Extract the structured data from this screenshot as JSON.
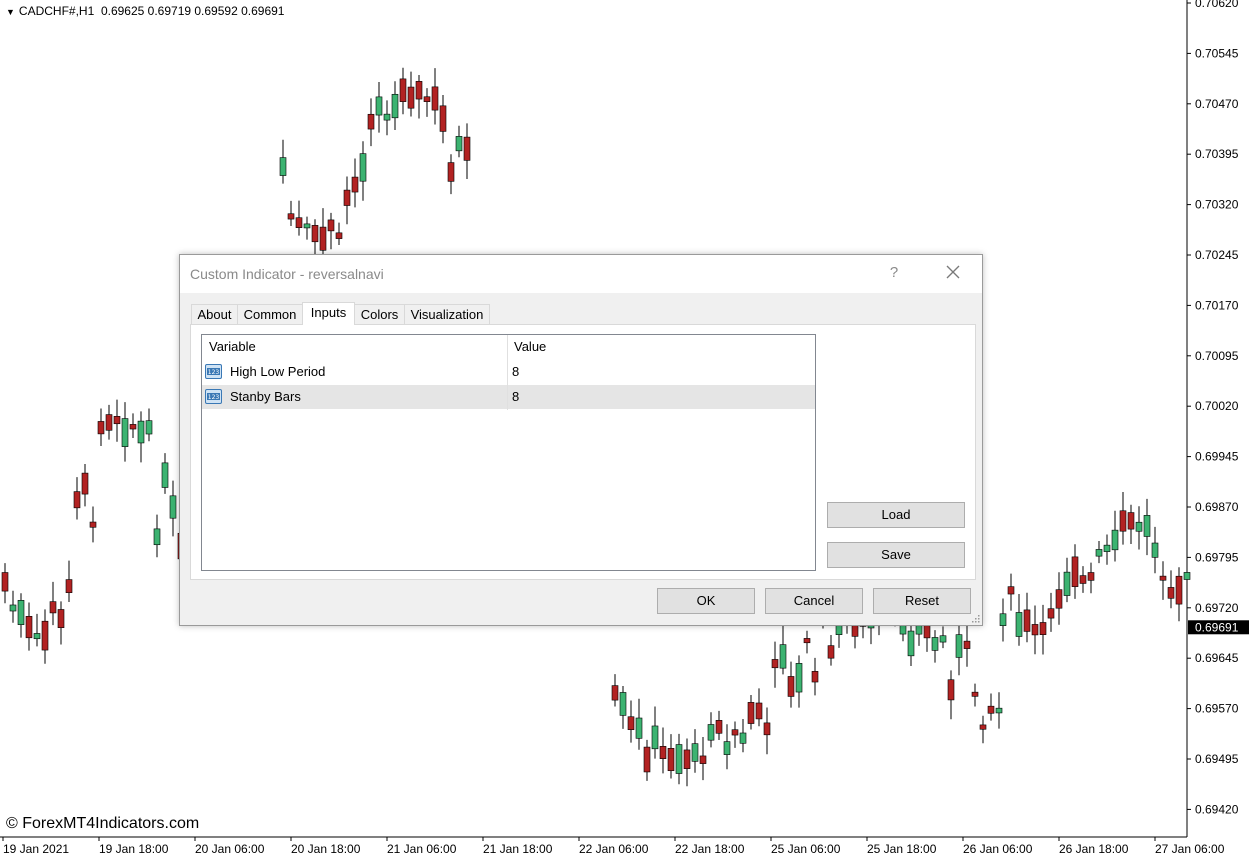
{
  "chart": {
    "symbol": "CADCHF#,H1",
    "ohlc": "0.69625 0.69719 0.69592 0.69691",
    "current_price": "0.69691",
    "watermark": "© ForexMT4Indicators.com",
    "price_labels": [
      "0.70620",
      "0.70545",
      "0.70470",
      "0.70395",
      "0.70320",
      "0.70245",
      "0.70170",
      "0.70095",
      "0.70020",
      "0.69945",
      "0.69870",
      "0.69795",
      "0.69720",
      "0.69645",
      "0.69570",
      "0.69495",
      "0.69420"
    ],
    "time_labels": [
      "19 Jan 2021",
      "19 Jan 18:00",
      "20 Jan 06:00",
      "20 Jan 18:00",
      "21 Jan 06:00",
      "21 Jan 18:00",
      "22 Jan 06:00",
      "22 Jan 18:00",
      "25 Jan 06:00",
      "25 Jan 18:00",
      "26 Jan 06:00",
      "26 Jan 18:00",
      "27 Jan 06:00"
    ],
    "colors": {
      "bull": "#3cb371",
      "bear": "#b22222",
      "up_line": "#cc0000",
      "down_line": "#00008b",
      "current_price_bg": "#000000"
    }
  },
  "dialog": {
    "title": "Custom Indicator - reversalnavi",
    "help": "?",
    "tabs": [
      {
        "label": "About"
      },
      {
        "label": "Common"
      },
      {
        "label": "Inputs"
      },
      {
        "label": "Colors"
      },
      {
        "label": "Visualization"
      }
    ],
    "active_tab": "Inputs",
    "grid": {
      "headers": {
        "variable": "Variable",
        "value": "Value"
      },
      "rows": [
        {
          "variable": "High Low Period",
          "value": "8",
          "icon": "integer-type-icon"
        },
        {
          "variable": "Stanby Bars",
          "value": "8",
          "icon": "integer-type-icon"
        }
      ]
    },
    "buttons": {
      "load": "Load",
      "save": "Save",
      "ok": "OK",
      "cancel": "Cancel",
      "reset": "Reset"
    }
  }
}
